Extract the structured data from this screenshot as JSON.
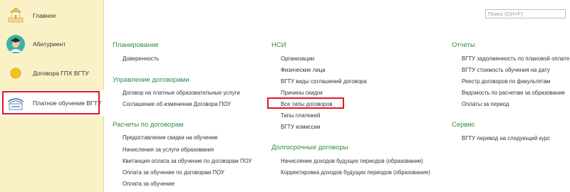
{
  "sidebar": {
    "items": [
      {
        "label": "Главное",
        "icon": "home-icon"
      },
      {
        "label": "Абитуриент",
        "icon": "graduate-avatar-icon"
      },
      {
        "label": "Договора ГПХ ВГТУ",
        "icon": "yellow-circle-icon"
      },
      {
        "label": "Платное обучение ВГТУ",
        "icon": "vgtu-logo-icon"
      }
    ]
  },
  "search": {
    "placeholder": "Поиск (Ctrl+F)"
  },
  "sections": {
    "planning": {
      "title": "Планирование",
      "links": [
        "Доверенность"
      ]
    },
    "contract_management": {
      "title": "Управление договорами",
      "links": [
        "Договор на платные образовательные услуги",
        "Соглашение об изменении Договора ПОУ"
      ]
    },
    "contract_settlements": {
      "title": "Расчеты по договорам",
      "links": [
        "Предоставление скидки на обучение",
        "Начисления за услуги образования",
        "Квитанция оплата за обучение по договорам ПОУ",
        "Оплата за обучение по договорам ПОУ",
        "Оплата за обучение"
      ]
    },
    "nsi": {
      "title": "НСИ",
      "links": [
        "Организации",
        "Физические лица",
        "ВГТУ виды соглашений договора",
        "Причины скидок",
        "Все типы договоров",
        "Типы платежей",
        "ВГТУ комиссии"
      ]
    },
    "long_term": {
      "title": "Долгосрочные договоры",
      "links": [
        "Начисление доходов будущих периодов (образование)",
        "Корректировка доходов будущих периодов (образование)"
      ]
    },
    "reports": {
      "title": "Отчеты",
      "links": [
        "ВГТУ задолженность по плановой оплате",
        "ВГТУ стоимость обучения на дату",
        "Реестр договоров по факультетам",
        "Ведомость по расчетам за образование",
        "Оплаты за период"
      ]
    },
    "service": {
      "title": "Сервис",
      "links": [
        "ВГТУ перевод на следующий курс"
      ]
    }
  },
  "colors": {
    "accent_green": "#2e8b44",
    "sidebar_bg": "#fbf1c6",
    "highlight_red": "#e01a22"
  }
}
